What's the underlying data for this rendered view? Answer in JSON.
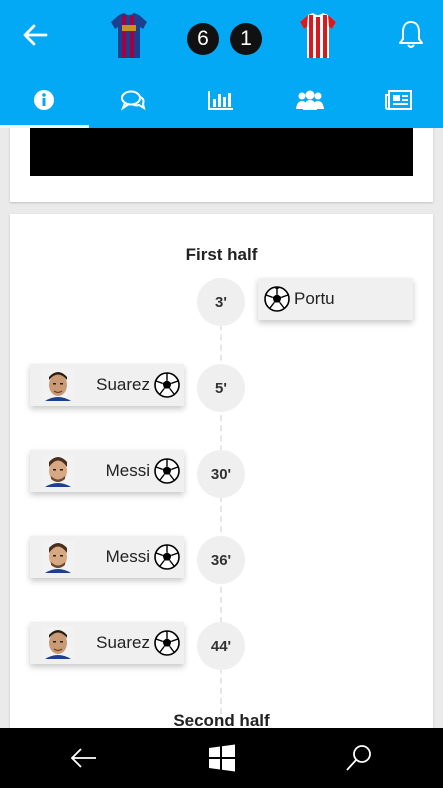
{
  "match": {
    "home_score": "6",
    "away_score": "1"
  },
  "tabs": [
    {
      "id": "info",
      "icon": "info-icon",
      "active": true
    },
    {
      "id": "comments",
      "icon": "chat-icon",
      "active": false
    },
    {
      "id": "stats",
      "icon": "bar-chart-icon",
      "active": false
    },
    {
      "id": "lineups",
      "icon": "people-icon",
      "active": false
    },
    {
      "id": "news",
      "icon": "newspaper-icon",
      "active": false
    }
  ],
  "timeline": {
    "first_half_label": "First half",
    "second_half_label": "Second half",
    "events": [
      {
        "minute": "3'",
        "player": "Portu",
        "side": "away",
        "type": "goal"
      },
      {
        "minute": "5'",
        "player": "Suarez",
        "side": "home",
        "type": "goal"
      },
      {
        "minute": "30'",
        "player": "Messi",
        "side": "home",
        "type": "goal"
      },
      {
        "minute": "36'",
        "player": "Messi",
        "side": "home",
        "type": "goal"
      },
      {
        "minute": "44'",
        "player": "Suarez",
        "side": "home",
        "type": "goal"
      }
    ]
  },
  "colors": {
    "header": "#03a9f4",
    "home_jersey_primary": "#1d3f8f",
    "home_jersey_secondary": "#a50044",
    "away_jersey_primary": "#d71920",
    "away_jersey_secondary": "#ffffff"
  }
}
